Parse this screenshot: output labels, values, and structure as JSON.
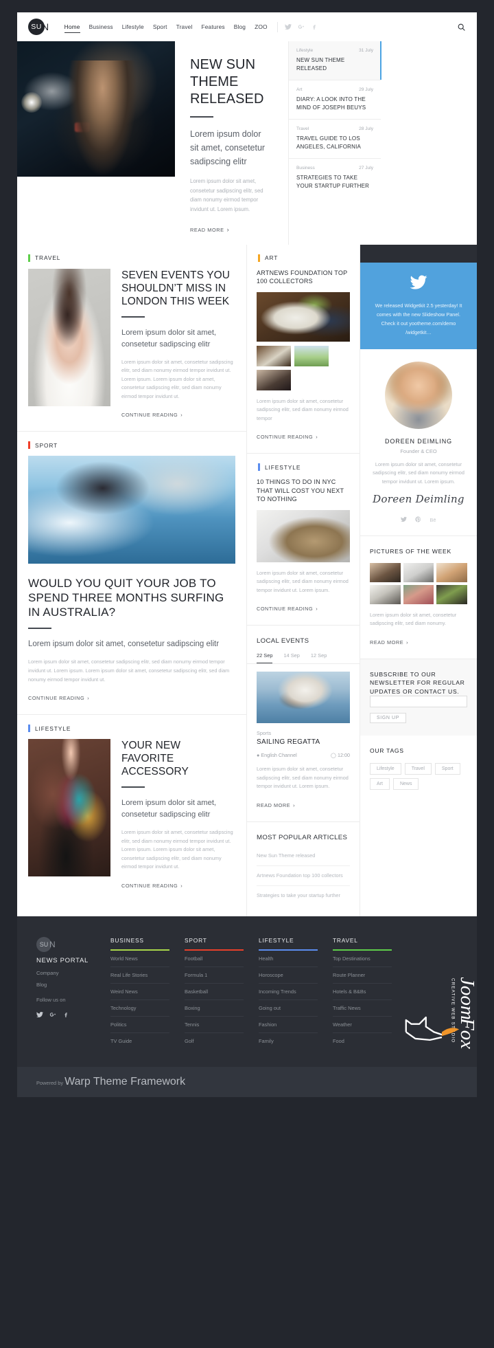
{
  "header": {
    "logo_mark": "SU",
    "logo_rest": "N",
    "nav": [
      {
        "label": "Home",
        "active": true
      },
      {
        "label": "Business",
        "active": false
      },
      {
        "label": "Lifestyle",
        "active": false
      },
      {
        "label": "Sport",
        "active": false
      },
      {
        "label": "Travel",
        "active": false
      },
      {
        "label": "Features",
        "active": false
      },
      {
        "label": "Blog",
        "active": false
      },
      {
        "label": "ZOO",
        "active": false
      }
    ],
    "social": [
      "twitter-icon",
      "google-plus-icon",
      "facebook-icon"
    ],
    "search": "search-icon"
  },
  "hero": {
    "title": "NEW SUN THEME RELEASED",
    "lead": "Lorem ipsum dolor sit amet, consetetur sadipscing elitr",
    "body": "Lorem ipsum dolor sit amet, consetetur sadipscing elitr, sed diam nonumy eirmod tempor invidunt ut. Lorem ipsum.",
    "read_more": "READ MORE"
  },
  "hero_news": [
    {
      "category": "Lifestyle",
      "date": "31 July",
      "title": "NEW SUN THEME RELEASED",
      "active": true
    },
    {
      "category": "Art",
      "date": "29 July",
      "title": "DIARY: A LOOK INTO THE MIND OF JOSEPH BEUYS",
      "active": false
    },
    {
      "category": "Travel",
      "date": "28 July",
      "title": "TRAVEL GUIDE TO LOS ANGELES, CALIFORNIA",
      "active": false
    },
    {
      "category": "Business",
      "date": "27 July",
      "title": "STRATEGIES TO TAKE YOUR STARTUP FURTHER",
      "active": false
    }
  ],
  "travel": {
    "kicker": "TRAVEL",
    "kicker_color": "#5ece4a",
    "title": "SEVEN EVENTS YOU SHOULDN’T MISS IN LONDON THIS WEEK",
    "lead": "Lorem ipsum dolor sit amet, consetetur sadipscing elitr",
    "body": "Lorem ipsum dolor sit amet, consetetur sadipscing elitr, sed diam nonumy eirmod tempor invidunt ut. Lorem ipsum. Lorem ipsum dolor sit amet, consetetur sadipscing elitr, sed diam nonumy eirmod tempor invidunt ut.",
    "cta": "CONTINUE READING"
  },
  "sport": {
    "kicker": "SPORT",
    "kicker_color": "#f0402a",
    "title": "WOULD YOU QUIT YOUR JOB TO SPEND THREE MONTHS SURFING IN AUSTRALIA?",
    "lead": "Lorem ipsum dolor sit amet, consetetur sadipscing elitr",
    "body": "Lorem ipsum dolor sit amet, consetetur sadipscing elitr, sed diam nonumy eirmod tempor invidunt ut. Lorem ipsum. Lorem ipsum dolor sit amet, consetetur sadipscing elitr, sed diam nonumy eirmod tempor invidunt ut.",
    "cta": "CONTINUE READING"
  },
  "lifestyle_main": {
    "kicker": "LIFESTYLE",
    "kicker_color": "#5b8def",
    "title": "YOUR NEW FAVORITE ACCESSORY",
    "lead": "Lorem ipsum dolor sit amet, consetetur sadipscing elitr",
    "body": "Lorem ipsum dolor sit amet, consetetur sadipscing elitr, sed diam nonumy eirmod tempor invidunt ut. Lorem ipsum. Lorem ipsum dolor sit amet, consetetur sadipscing elitr, sed diam nonumy eirmod tempor invidunt ut.",
    "cta": "CONTINUE READING"
  },
  "art": {
    "kicker": "ART",
    "kicker_color": "#f5a623",
    "title": "ARTNEWS FOUNDATION TOP 100 COLLECTORS",
    "body": "Lorem ipsum dolor sit amet, consetetur sadipscing elitr, sed diam nonumy eirmod tempor",
    "cta": "CONTINUE READING"
  },
  "lifestyle_mid": {
    "kicker": "LIFESTYLE",
    "kicker_color": "#5b8def",
    "title": "10 THINGS TO DO IN NYC THAT WILL COST YOU NEXT TO NOTHING",
    "body": "Lorem ipsum dolor sit amet, consetetur sadipscing elitr, sed diam nonumy eirmod tempor invidunt ut. Lorem ipsum.",
    "cta": "CONTINUE READING"
  },
  "local_events": {
    "title": "LOCAL EVENTS",
    "tabs": [
      {
        "label": "22 Sep",
        "active": true
      },
      {
        "label": "14 Sep",
        "active": false
      },
      {
        "label": "12 Sep",
        "active": false
      }
    ],
    "category": "Sports",
    "event_title": "SAILING REGATTA",
    "location": "English Channel",
    "time": "12:00",
    "body": "Lorem ipsum dolor sit amet, consetetur sadipscing elitr, sed diam nonumy eirmod tempor invidunt ut. Lorem ipsum.",
    "cta": "READ MORE"
  },
  "most_popular": {
    "title": "MOST POPULAR ARTICLES",
    "items": [
      "New Sun Theme released",
      "Artnews Foundation top 100 collectors",
      "Strategies to take your startup further"
    ]
  },
  "twitter_card": {
    "icon": "twitter-icon",
    "text": "We released Widgetkit 2.5 yesterday! It comes with the new Slideshow Panel. Check it out yootheme.com/demo /widgetkit…",
    "bg": "#51a2dd"
  },
  "author": {
    "name": "DOREEN DEIMLING",
    "role": "Founder & CEO",
    "bio": "Lorem ipsum dolor sit amet, consetetur sadipscing elitr, sed diam nonumy eirmod tempor invidunt ut. Lorem ipsum.",
    "signature": "Doreen Deimling",
    "social": [
      "twitter-icon",
      "pinterest-icon",
      "behance-icon"
    ]
  },
  "pictures": {
    "title": "PICTURES OF THE WEEK",
    "body": "Lorem ipsum dolor sit amet, consetetur sadipscing elitr, sed diam nonumy.",
    "cta": "READ MORE"
  },
  "subscribe": {
    "title": "SUBSCRIBE TO OUR NEWSLETTER FOR REGULAR UPDATES OR CONTACT US.",
    "input_value": "",
    "input_placeholder": "",
    "button": "SIGN UP"
  },
  "tags": {
    "title": "OUR TAGS",
    "items": [
      "Lifestyle",
      "Travel",
      "Sport",
      "Art",
      "News"
    ]
  },
  "footer": {
    "logo_mark": "SU",
    "logo_rest": "N",
    "portal": "NEWS PORTAL",
    "links": [
      "Company",
      "Blog"
    ],
    "follow": "Follow us on",
    "social": [
      "twitter-icon",
      "google-plus-icon",
      "facebook-icon"
    ],
    "columns": [
      {
        "title": "BUSINESS",
        "color": "#a8d64a",
        "items": [
          "World News",
          "Real Life Stories",
          "Weird News",
          "Technology",
          "Politics",
          "TV Guide"
        ]
      },
      {
        "title": "SPORT",
        "color": "#e8402a",
        "items": [
          "Football",
          "Formula 1",
          "Basketball",
          "Boxing",
          "Tennis",
          "Golf"
        ]
      },
      {
        "title": "LIFESTYLE",
        "color": "#5b8def",
        "items": [
          "Health",
          "Horoscope",
          "Incoming Trends",
          "Going out",
          "Fashion",
          "Family"
        ]
      },
      {
        "title": "TRAVEL",
        "color": "#5ece4a",
        "items": [
          "Top Destinations",
          "Route Planner",
          "Hotels & B&Bs",
          "Traffic News",
          "Weather",
          "Food"
        ]
      }
    ],
    "powered_prefix": "Powered by ",
    "powered_link": "Warp Theme Framework"
  },
  "watermark": {
    "brand": "Joom",
    "brand2": "Fox",
    "tagline": "CREATIVE WEB STUDIO"
  }
}
